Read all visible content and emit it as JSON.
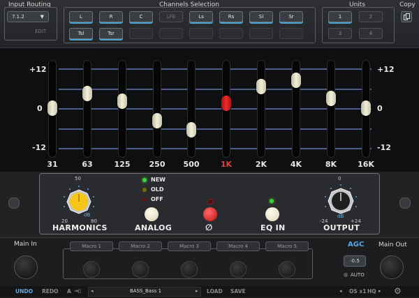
{
  "colors": {
    "accent": "#4ba3d8",
    "led_green": "#3ed33e",
    "red": "#e03030"
  },
  "top": {
    "input_routing": {
      "title": "Input Routing",
      "value": "7.1.2",
      "edit": "EDIT"
    },
    "channels": {
      "title": "Channels Selection",
      "row1": [
        {
          "label": "L",
          "state": "on"
        },
        {
          "label": "R",
          "state": "on"
        },
        {
          "label": "C",
          "state": "on"
        },
        {
          "label": "LFE",
          "state": "off"
        },
        {
          "label": "Ls",
          "state": "on"
        },
        {
          "label": "Rs",
          "state": "on"
        },
        {
          "label": "Sl",
          "state": "on"
        },
        {
          "label": "Sr",
          "state": "on"
        }
      ],
      "row2": [
        {
          "label": "Tsl",
          "state": "on"
        },
        {
          "label": "Tsr",
          "state": "on"
        }
      ]
    },
    "units": {
      "title": "Units",
      "buttons": [
        "1",
        "2",
        "3",
        "4"
      ],
      "selected": "1"
    },
    "copy": {
      "title": "Copy"
    }
  },
  "eq": {
    "scale_left": [
      "+12",
      "0",
      "-12"
    ],
    "scale_right": [
      "+12",
      "0",
      "-12"
    ],
    "bands": [
      {
        "freq": "31",
        "gain": 0
      },
      {
        "freq": "63",
        "gain": 4.5
      },
      {
        "freq": "125",
        "gain": 2.2
      },
      {
        "freq": "250",
        "gain": -3.8
      },
      {
        "freq": "500",
        "gain": -6.5
      },
      {
        "freq": "1K",
        "gain": 1.5,
        "active": true
      },
      {
        "freq": "2K",
        "gain": 6.5
      },
      {
        "freq": "4K",
        "gain": 8.5
      },
      {
        "freq": "8K",
        "gain": 3.0
      },
      {
        "freq": "16K",
        "gain": 0
      }
    ]
  },
  "harmonics": {
    "harmonics": {
      "label": "HARMONICS",
      "max": "50",
      "min": "20",
      "mid": "80",
      "unit": "dB"
    },
    "analog": {
      "label": "ANALOG",
      "options": [
        "NEW",
        "OLD",
        "OFF"
      ],
      "selected": "NEW"
    },
    "phase": {
      "symbol": "∅"
    },
    "eq_in": {
      "label": "EQ IN"
    },
    "output": {
      "label": "OUTPUT",
      "top": "0",
      "min": "-24",
      "max": "+24",
      "unit": "dB"
    }
  },
  "bottom": {
    "main_in": "Main In",
    "macros": [
      "Macro 1",
      "Macro 2",
      "Macro 3",
      "Macro 4",
      "Macro 5"
    ],
    "agc": {
      "label": "AGC",
      "value": "-0.5",
      "auto": "AUTO"
    },
    "main_out": "Main Out"
  },
  "status": {
    "undo": "UNDO",
    "redo": "REDO",
    "ab": "A",
    "preset": "BASS_Bass 1",
    "load": "LOAD",
    "save": "SAVE",
    "os": "OS x1",
    "hq": "HQ"
  }
}
